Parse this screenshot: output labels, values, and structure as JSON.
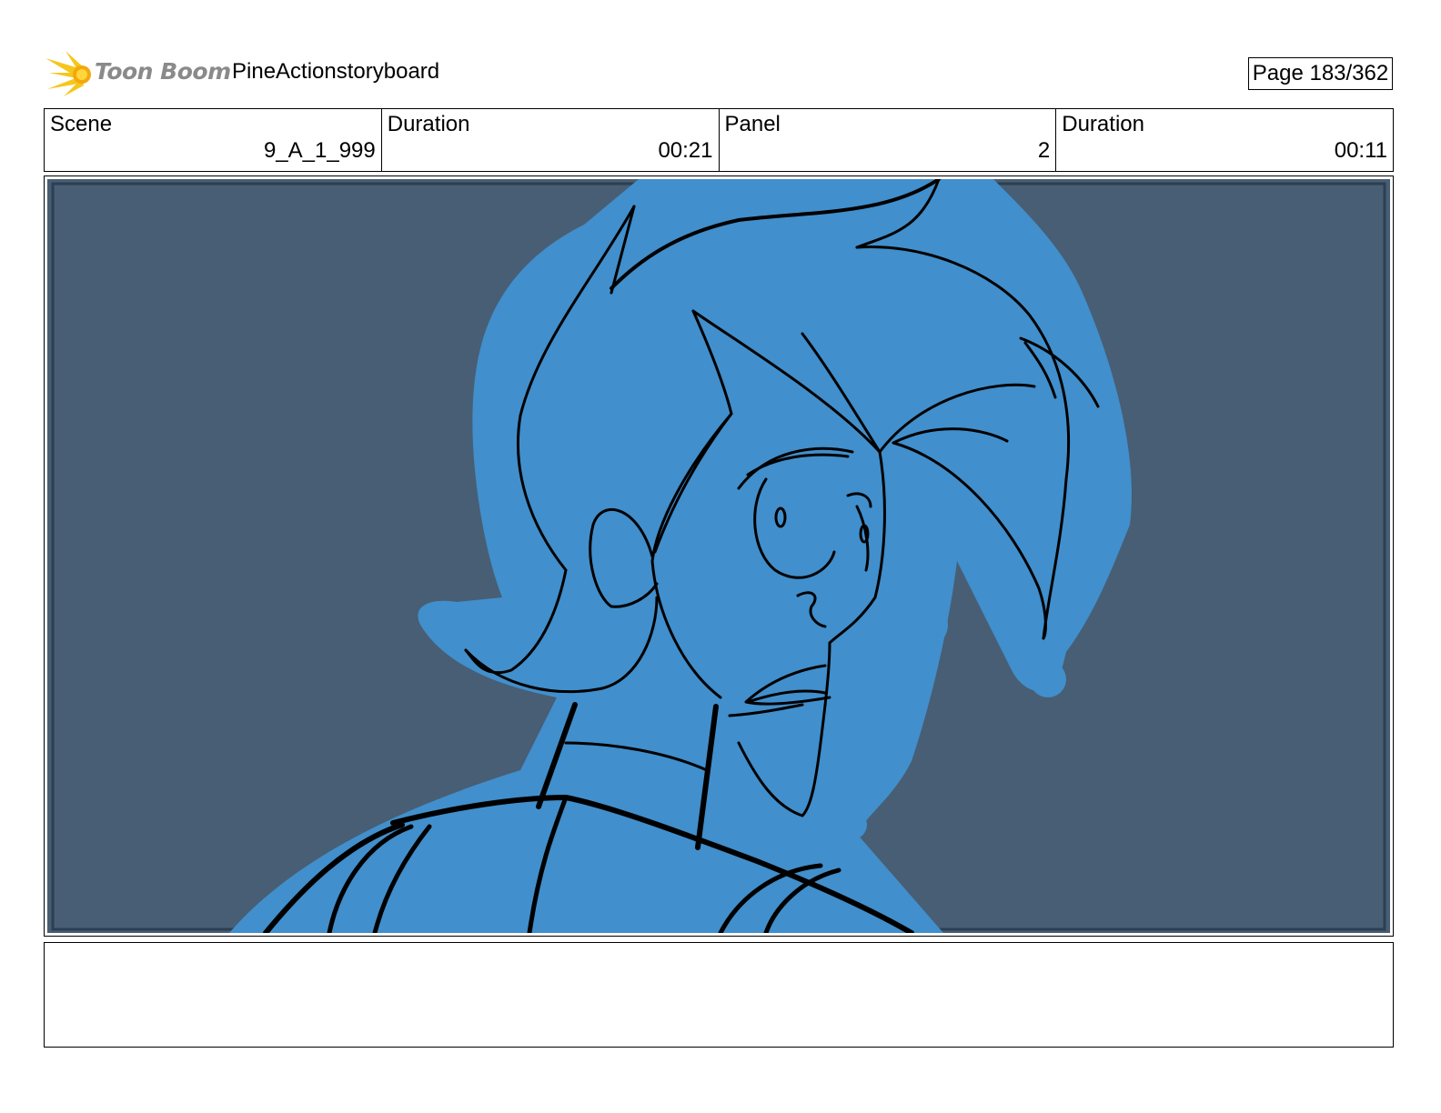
{
  "header": {
    "logo_text": "Toon Boom",
    "project_name": "PineActionstoryboard",
    "page_label": "Page 183/362"
  },
  "info": {
    "scene_label": "Scene",
    "scene_value": "9_A_1_999",
    "scene_duration_label": "Duration",
    "scene_duration_value": "00:21",
    "panel_label": "Panel",
    "panel_value": "2",
    "panel_duration_label": "Duration",
    "panel_duration_value": "00:11"
  },
  "panel": {
    "background_color": "#475e74",
    "figure_color": "#418fcc",
    "line_color": "#000000"
  },
  "notes": {
    "text": ""
  }
}
